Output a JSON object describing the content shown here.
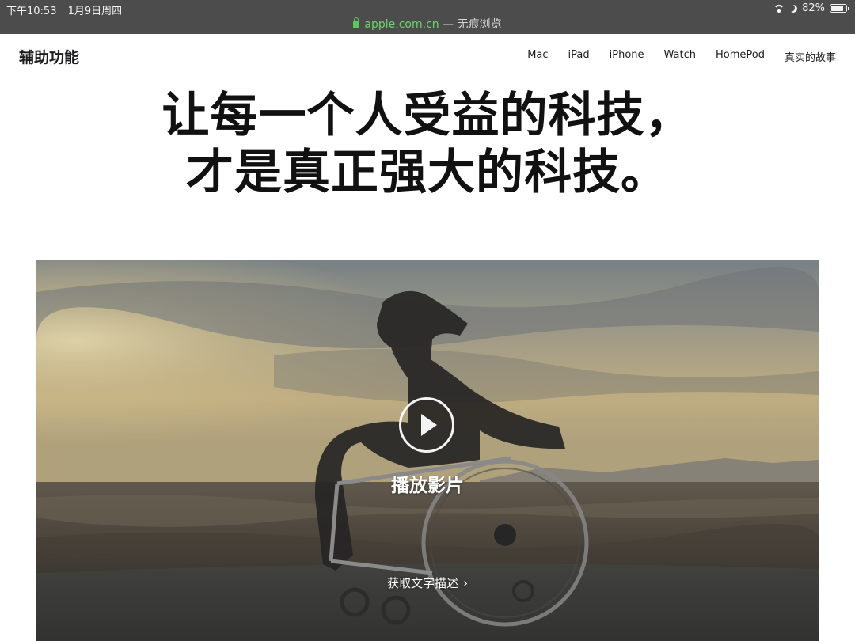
{
  "status_bar": {
    "time": "下午10:53",
    "date": "1月9日周四",
    "battery": "82%",
    "battery_level": 0.82
  },
  "url_bar": {
    "domain": "apple.com.cn",
    "suffix": " — 无痕浏览"
  },
  "local_nav": {
    "title": "辅助功能",
    "items": [
      {
        "label": "Mac"
      },
      {
        "label": "iPad"
      },
      {
        "label": "iPhone"
      },
      {
        "label": "Watch"
      },
      {
        "label": "HomePod"
      },
      {
        "label": "真实的故事"
      }
    ]
  },
  "headline": {
    "line1": "让每一个人受益的科技，",
    "line2": "才是真正强大的科技。"
  },
  "hero": {
    "play_label": "播放影片",
    "description_link": "获取文字描述",
    "chevron": "›"
  }
}
